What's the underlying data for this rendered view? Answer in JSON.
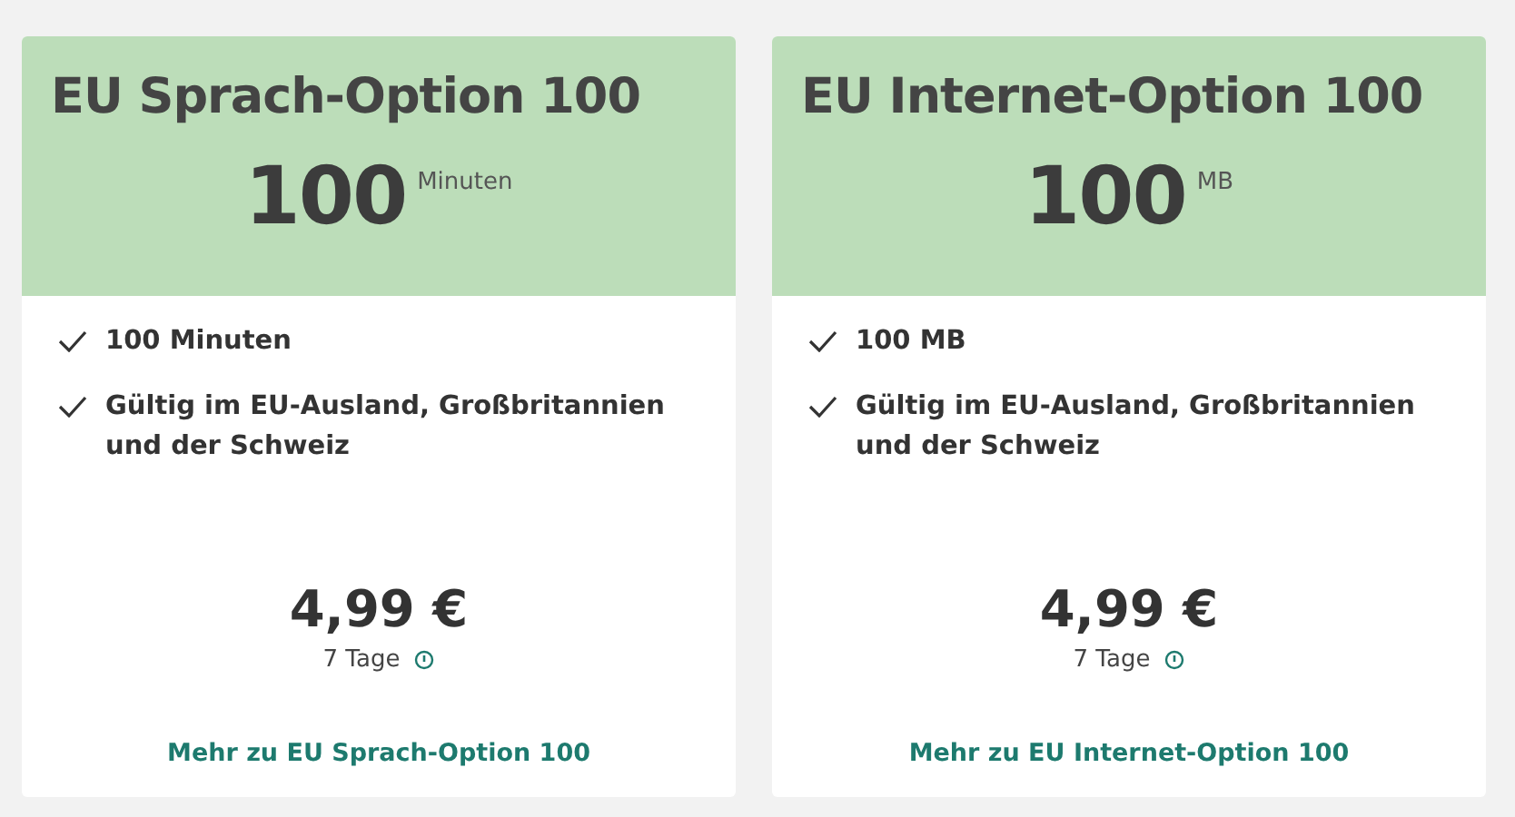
{
  "cards": [
    {
      "title": "EU Sprach-Option 100",
      "amount": "100",
      "unit": "Minuten",
      "features": [
        "100 Minuten",
        "Gültig im EU-Ausland, Großbritannien und der Schweiz"
      ],
      "price": "4,99 €",
      "period": "7 Tage",
      "link": "Mehr zu EU Sprach-Option 100"
    },
    {
      "title": "EU Internet-Option 100",
      "amount": "100",
      "unit": "MB",
      "features": [
        "100 MB",
        "Gültig im EU-Ausland, Großbritannien und der Schweiz"
      ],
      "price": "4,99 €",
      "period": "7 Tage",
      "link": "Mehr zu EU Internet-Option 100"
    }
  ]
}
